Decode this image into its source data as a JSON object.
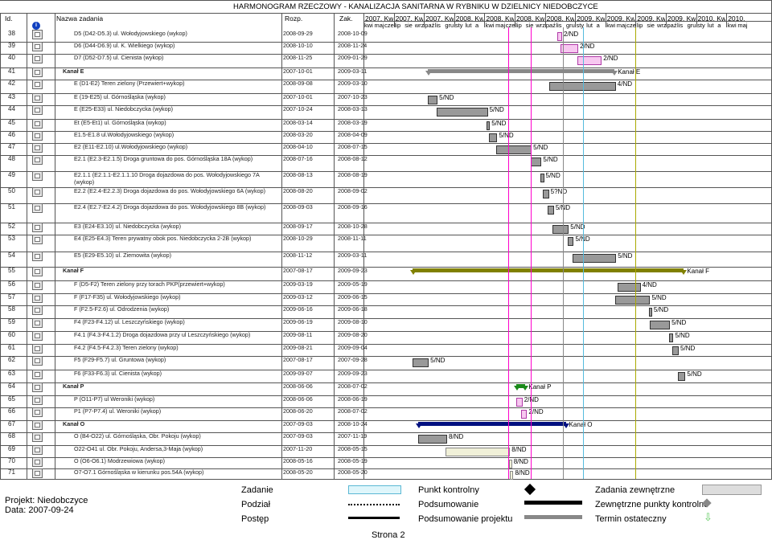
{
  "header": {
    "title": "HARMONOGRAM RZECZOWY - KANALIZACJA SANITARNA W RYBNIKU W DZIELNICY NIEDOBCZYCE",
    "col_id": "Id.",
    "col_name": "Nazwa zadania",
    "col_start": "Rozp.",
    "col_end": "Zak.",
    "info_icon": "i",
    "quarters": [
      "2007, Kw",
      "2007, Kw",
      "2007, Kw",
      "2008, Kw",
      "2008, Kw",
      "2008, Kw",
      "2008, Kw",
      "2009, Kw",
      "2009, Kw",
      "2009, Kw",
      "2009, Kw",
      "2010, Kw",
      "2010,"
    ],
    "months": [
      "kwi",
      "maj",
      "cze",
      "lip",
      "sie",
      "wrz",
      "paź",
      "lis",
      "gru",
      "sty",
      "lut",
      "a",
      "kwi",
      "maj",
      "cze",
      "lip",
      "sie",
      "wrz",
      "paź",
      "lis",
      "gru",
      "sty",
      "lut",
      "a",
      "kwi",
      "maj",
      "cze",
      "lip",
      "sie",
      "wrz",
      "paź",
      "lis",
      "gru",
      "sty",
      "lut",
      "a",
      "kwi",
      "maj"
    ]
  },
  "rows": [
    {
      "id": "38",
      "name": "D5 (D42-D5.3) ul. Wołodyjowskiego (wykop)",
      "start": "2008-09-29",
      "end": "2008-10-09",
      "label": "2/ND"
    },
    {
      "id": "39",
      "name": "D6 (D44-D6.9) ul. K. Wielkiego (wykop)",
      "start": "2008-10-10",
      "end": "2008-11-24",
      "label": "2/ND"
    },
    {
      "id": "40",
      "name": "D7 (D52-D7.5) ul. Cienista (wykop)",
      "start": "2008-11-25",
      "end": "2009-01-29",
      "label": "2/ND"
    },
    {
      "id": "41",
      "name": "Kanał E",
      "start": "2007-10-01",
      "end": "2009-03-11",
      "label": "Kanał E",
      "bold": true
    },
    {
      "id": "42",
      "name": "E (D1-E2) Teren zielony (Przewiert+wykop)",
      "start": "2008-09-08",
      "end": "2009-03-10",
      "label": "4/ND"
    },
    {
      "id": "43",
      "name": "E (19-E25) ul. Górnośląska (wykop)",
      "start": "2007-10-01",
      "end": "2007-10-23",
      "label": "5/ND"
    },
    {
      "id": "44",
      "name": "E (E25-E33) ul. Niedobczycka (wykop)",
      "start": "2007-10-24",
      "end": "2008-03-13",
      "label": "5/ND"
    },
    {
      "id": "45",
      "name": "Et (E5-Et1) ul. Górnośląska (wykop)",
      "start": "2008-03-14",
      "end": "2008-03-19",
      "label": "5/ND"
    },
    {
      "id": "46",
      "name": "E1.5-E1.8 ul.Wołodyjowskiego (wykop)",
      "start": "2008-03-20",
      "end": "2008-04-09",
      "label": "5/ND"
    },
    {
      "id": "47",
      "name": "E2 (E11-E2.10) ul.Wołodyjowskiego (wykop)",
      "start": "2008-04-10",
      "end": "2008-07-15",
      "label": "5/ND"
    },
    {
      "id": "48",
      "name": "E2.1 (E2.3-E2.1.5) Droga gruntowa do pos. Górnośląska 18A (wykop)",
      "start": "2008-07-16",
      "end": "2008-08-12",
      "label": "5/ND"
    },
    {
      "id": "49",
      "name": "E2.1.1 (E2.1.1-E2.1.1.10 Droga dojazdowa do pos. Wołodyjowskiego 7A (wykop)",
      "start": "2008-08-13",
      "end": "2008-08-19",
      "label": "5/ND"
    },
    {
      "id": "50",
      "name": "E2.2 (E2.4-E2.2.3) Droga dojazdowa do pos. Wołodyjowskiego 6A (wykop)",
      "start": "2008-08-20",
      "end": "2008-09-02",
      "label": "5?ND"
    },
    {
      "id": "51",
      "name": "E2.4 (E2.7-E2.4.2) Droga dojazdowa do pos. Wołodyjowskiego 8B (wykop)",
      "start": "2008-09-03",
      "end": "2008-09-16",
      "label": "5/ND"
    },
    {
      "id": "52",
      "name": "E3 (E24-E3.10) ul. Niedobczycka (wykop)",
      "start": "2008-09-17",
      "end": "2008-10-28",
      "label": "5/ND"
    },
    {
      "id": "53",
      "name": "E4 (E25-E4.3) Teren prywatny obok pos. Niedobczycka 2-2B (wykop)",
      "start": "2008-10-29",
      "end": "2008-11-11",
      "label": "5/ND"
    },
    {
      "id": "54",
      "name": "E5 (E29-E5.10) ul. Ziemowita (wykop)",
      "start": "2008-11-12",
      "end": "2009-03-11",
      "label": "5/ND"
    },
    {
      "id": "55",
      "name": "Kanał F",
      "start": "2007-08-17",
      "end": "2009-09-23",
      "label": "Kanał F",
      "bold": true
    },
    {
      "id": "56",
      "name": "F (D5-F2) Teren zielony przy torach PKP(przewiert+wykop)",
      "start": "2009-03-19",
      "end": "2009-05-19",
      "label": "4/ND"
    },
    {
      "id": "57",
      "name": "F (F17-F35) ul. Wołodyjowskiego (wykop)",
      "start": "2009-03-12",
      "end": "2009-06-15",
      "label": "5/ND"
    },
    {
      "id": "58",
      "name": "F (F2.5-F2.6) ul. Odrodzenia (wykop)",
      "start": "2009-06-16",
      "end": "2009-06-18",
      "label": "5/ND"
    },
    {
      "id": "59",
      "name": "F4 (F23-F4.12) ul. Leszczyńskiego (wykop)",
      "start": "2009-06-19",
      "end": "2009-08-10",
      "label": "5/ND"
    },
    {
      "id": "60",
      "name": "F4.1 (F4.3-F4.1.2) Droga dojazdowa przy ul Leszczyńskiego (wykop)",
      "start": "2009-08-11",
      "end": "2009-08-20",
      "label": "5/ND"
    },
    {
      "id": "61",
      "name": "F4.2 (F4.5-F4.2.3) Teren zielony (wykop)",
      "start": "2009-08-21",
      "end": "2009-09-04",
      "label": "5/ND"
    },
    {
      "id": "62",
      "name": "F5 (F29-F5.7) ul. Gruntowa (wykop)",
      "start": "2007-08-17",
      "end": "2007-09-28",
      "label": "5/ND"
    },
    {
      "id": "63",
      "name": "F6 (F33-F6.3) ul. Cienista (wykop)",
      "start": "2009-09-07",
      "end": "2009-09-23",
      "label": "5/ND"
    },
    {
      "id": "64",
      "name": "Kanał P",
      "start": "2008-06-06",
      "end": "2008-07-02",
      "label": "Kanał P",
      "bold": true
    },
    {
      "id": "65",
      "name": "P (O11-P7) ul Weroniki (wykop)",
      "start": "2008-06-06",
      "end": "2008-06-19",
      "label": "2/ND"
    },
    {
      "id": "66",
      "name": "P1 (P7-P7.4) ul. Weroniki (wykop)",
      "start": "2008-06-20",
      "end": "2008-07-02",
      "label": "2/ND"
    },
    {
      "id": "67",
      "name": "Kanał O",
      "start": "2007-09-03",
      "end": "2008-10-24",
      "label": "Kanał O",
      "bold": true
    },
    {
      "id": "68",
      "name": "O (B4-O22) ul. Górnośląska, Obr. Pokoju (wykop)",
      "start": "2007-09-03",
      "end": "2007-11-19",
      "label": "8/ND"
    },
    {
      "id": "69",
      "name": "O22-O41 ul. Obr. Pokoju, Andersa,3-Maja (wykop)",
      "start": "2007-11-20",
      "end": "2008-05-15",
      "label": "8/ND"
    },
    {
      "id": "70",
      "name": "O (O6-O6.1) Modrzewiowa (wykop)",
      "start": "2008-05-16",
      "end": "2008-05-19",
      "label": "8/ND"
    },
    {
      "id": "71",
      "name": "O7-O7.1 Górnośląska w kierunku pos.54A (wykop)",
      "start": "2008-05-20",
      "end": "2008-05-20",
      "label": "8/ND"
    }
  ],
  "legend": {
    "col1": [
      "Zadanie",
      "Podział",
      "Postęp"
    ],
    "col2": [
      "Punkt kontrolny",
      "Podsumowanie",
      "Podsumowanie projektu"
    ],
    "col3": [
      "Zadania zewnętrzne",
      "Zewnętrzne punkty kontrolne",
      "Termin ostateczny"
    ]
  },
  "footer": {
    "project": "Projekt: Niedobczyce",
    "date": "Data: 2007-09-24",
    "page": "Strona 2"
  }
}
